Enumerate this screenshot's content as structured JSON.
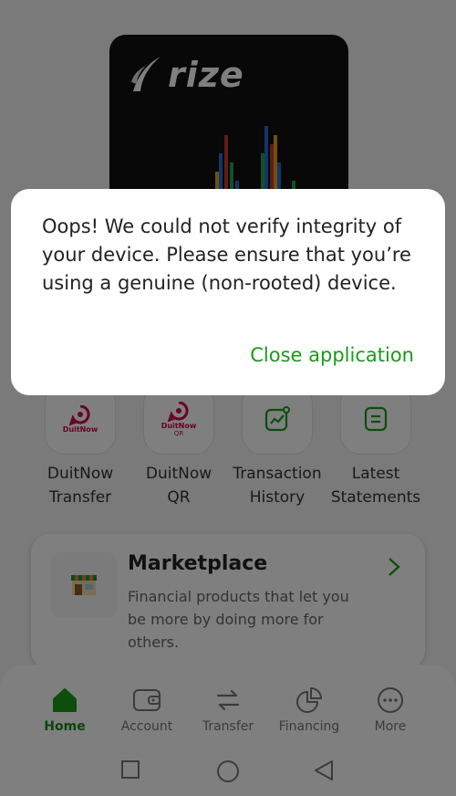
{
  "card": {
    "brand": "rize"
  },
  "actions": [
    {
      "line1": "DuitNow",
      "line2": "Transfer",
      "icon_text": "DuitNow"
    },
    {
      "line1": "DuitNow",
      "line2": "QR",
      "icon_text": "DuitNow",
      "icon_sub": "QR"
    },
    {
      "line1": "Transaction",
      "line2": "History"
    },
    {
      "line1": "Latest",
      "line2": "Statements"
    }
  ],
  "marketplace": {
    "title": "Marketplace",
    "description": "Financial products that let you be more by doing more for others."
  },
  "nav": [
    {
      "label": "Home"
    },
    {
      "label": "Account"
    },
    {
      "label": "Transfer"
    },
    {
      "label": "Financing"
    },
    {
      "label": "More"
    }
  ],
  "dialog": {
    "message": "Oops! We could not verify integrity of your device. Please ensure that you’re using a genuine (non-rooted) device.",
    "button": "Close application"
  },
  "colors": {
    "accent": "#1a9a1a",
    "duitnow": "#d6004c"
  }
}
